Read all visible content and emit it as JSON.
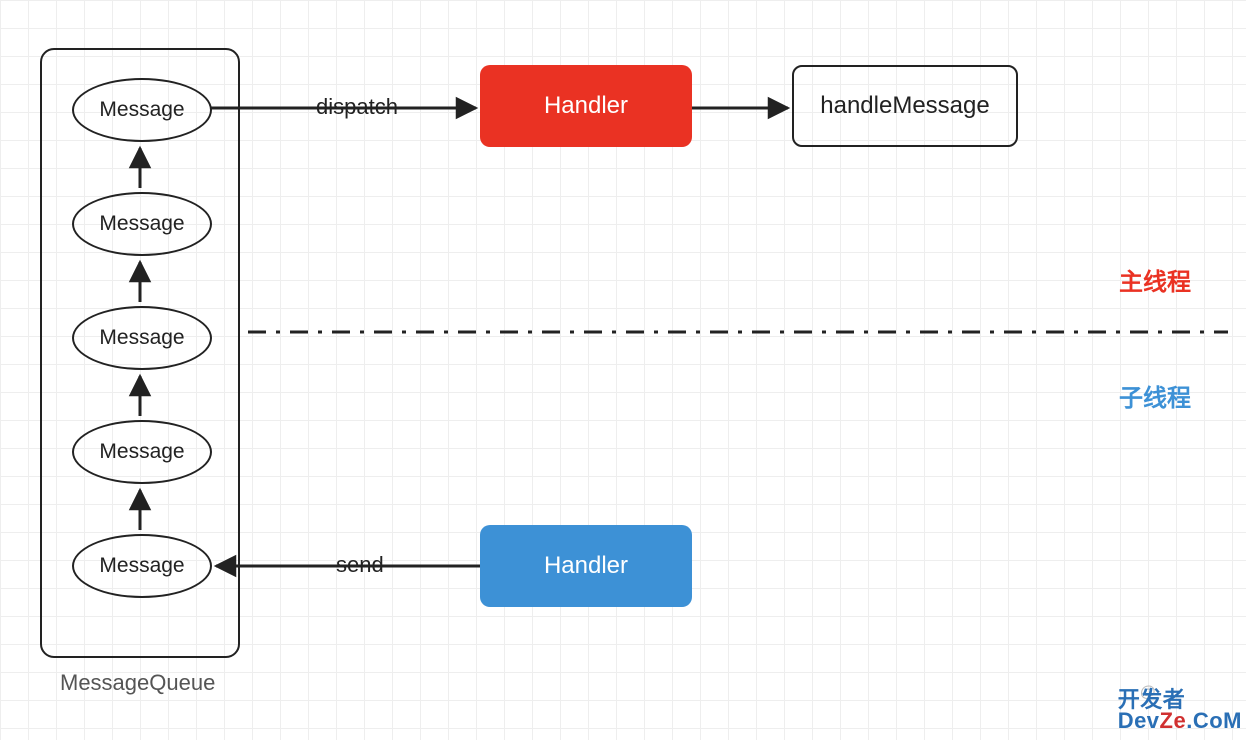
{
  "queue": {
    "label": "MessageQueue",
    "items": [
      "Message",
      "Message",
      "Message",
      "Message",
      "Message"
    ]
  },
  "handlers": {
    "main": "Handler",
    "child": "Handler",
    "callback": "handleMessage"
  },
  "edges": {
    "dispatch": "dispatch",
    "send": "send"
  },
  "threads": {
    "main": "主线程",
    "child": "子线程"
  },
  "watermark": {
    "author_prefix": "@",
    "logo_line1": "开发者",
    "logo_line2_a": "Dev",
    "logo_line2_b": "Ze",
    "logo_line2_c": ".CoM"
  }
}
